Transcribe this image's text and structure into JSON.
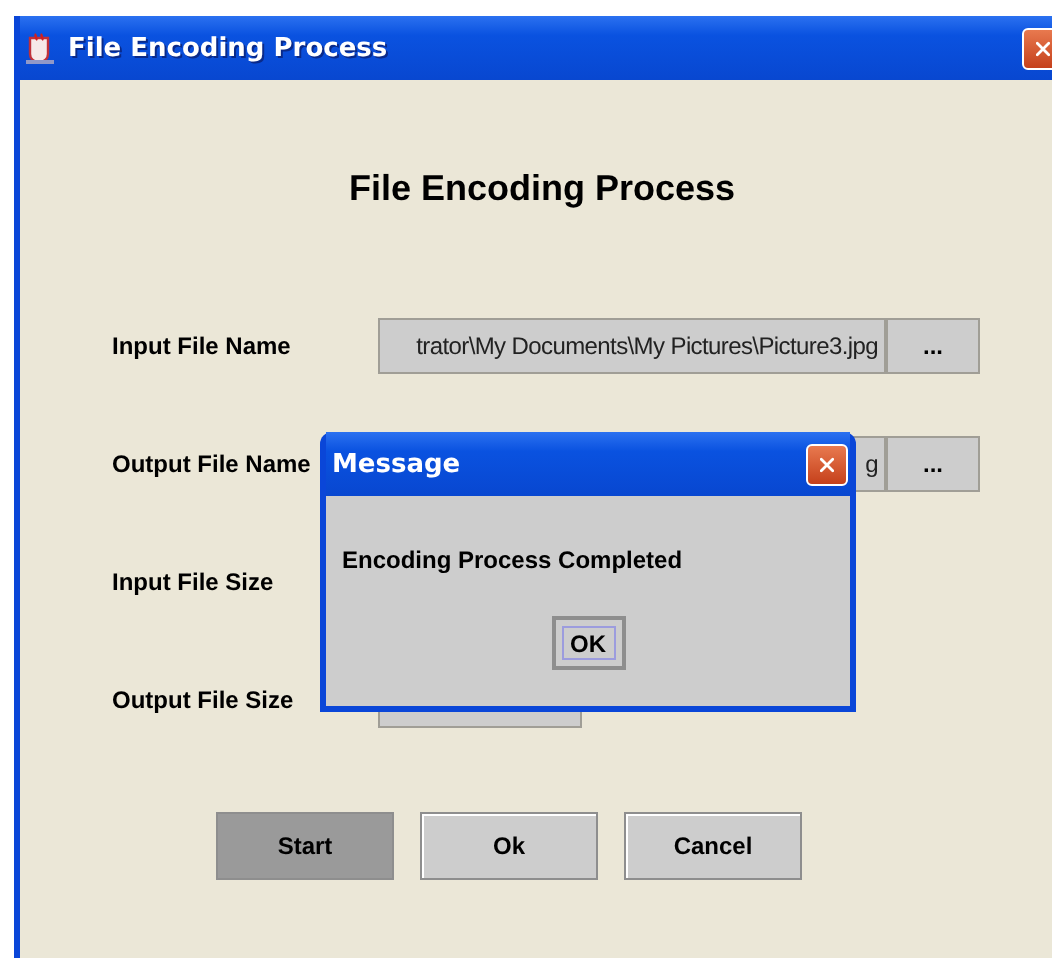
{
  "window": {
    "title": "File Encoding Process"
  },
  "heading": "File Encoding Process",
  "rows": [
    {
      "kind": "file",
      "label": "Input File Name",
      "value": "trator\\My Documents\\My Pictures\\Picture3.jpg",
      "browse": "..."
    },
    {
      "kind": "file",
      "label": "Output File Name",
      "value": "g",
      "browse": "..."
    },
    {
      "kind": "label",
      "label": "Input File Size"
    },
    {
      "kind": "size",
      "label": "Output File Size"
    }
  ],
  "buttons": [
    {
      "label": "Start",
      "pressed": true
    },
    {
      "label": "Ok",
      "pressed": false
    },
    {
      "label": "Cancel",
      "pressed": false
    }
  ],
  "dialog": {
    "title": "Message",
    "message": "Encoding Process Completed",
    "button": {
      "label": "OK",
      "focused": true
    }
  }
}
